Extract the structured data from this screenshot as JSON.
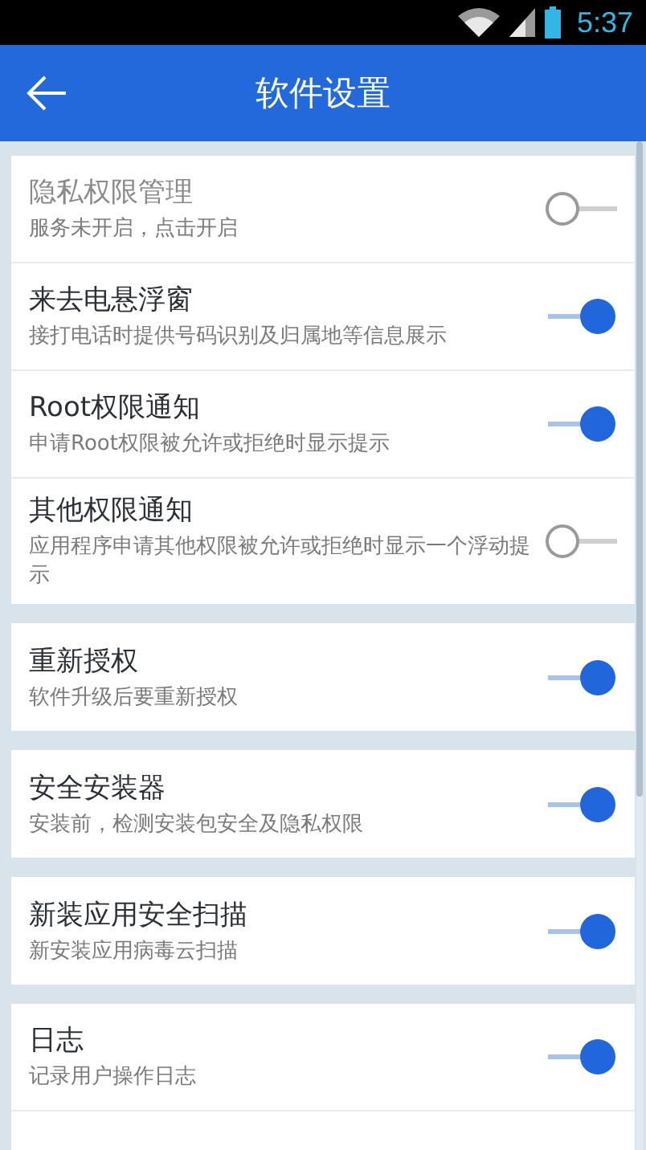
{
  "status_bar": {
    "time": "5:37"
  },
  "app_bar": {
    "title": "软件设置"
  },
  "groups": [
    {
      "items": [
        {
          "title": "隐私权限管理",
          "subtitle": "服务未开启，点击开启",
          "on": false,
          "disabled": true
        },
        {
          "title": "来去电悬浮窗",
          "subtitle": "接打电话时提供号码识别及归属地等信息展示",
          "on": true,
          "disabled": false
        },
        {
          "title": "Root权限通知",
          "subtitle": "申请Root权限被允许或拒绝时显示提示",
          "on": true,
          "disabled": false
        },
        {
          "title": "其他权限通知",
          "subtitle": "应用程序申请其他权限被允许或拒绝时显示一个浮动提示",
          "on": false,
          "disabled": false
        }
      ]
    },
    {
      "items": [
        {
          "title": "重新授权",
          "subtitle": "软件升级后要重新授权",
          "on": true,
          "disabled": false
        }
      ]
    },
    {
      "items": [
        {
          "title": "安全安装器",
          "subtitle": "安装前，检测安装包安全及隐私权限",
          "on": true,
          "disabled": false
        }
      ]
    },
    {
      "items": [
        {
          "title": "新装应用安全扫描",
          "subtitle": "新安装应用病毒云扫描",
          "on": true,
          "disabled": false
        }
      ]
    },
    {
      "items": [
        {
          "title": "日志",
          "subtitle": "记录用户操作日志",
          "on": true,
          "disabled": false
        }
      ]
    }
  ]
}
